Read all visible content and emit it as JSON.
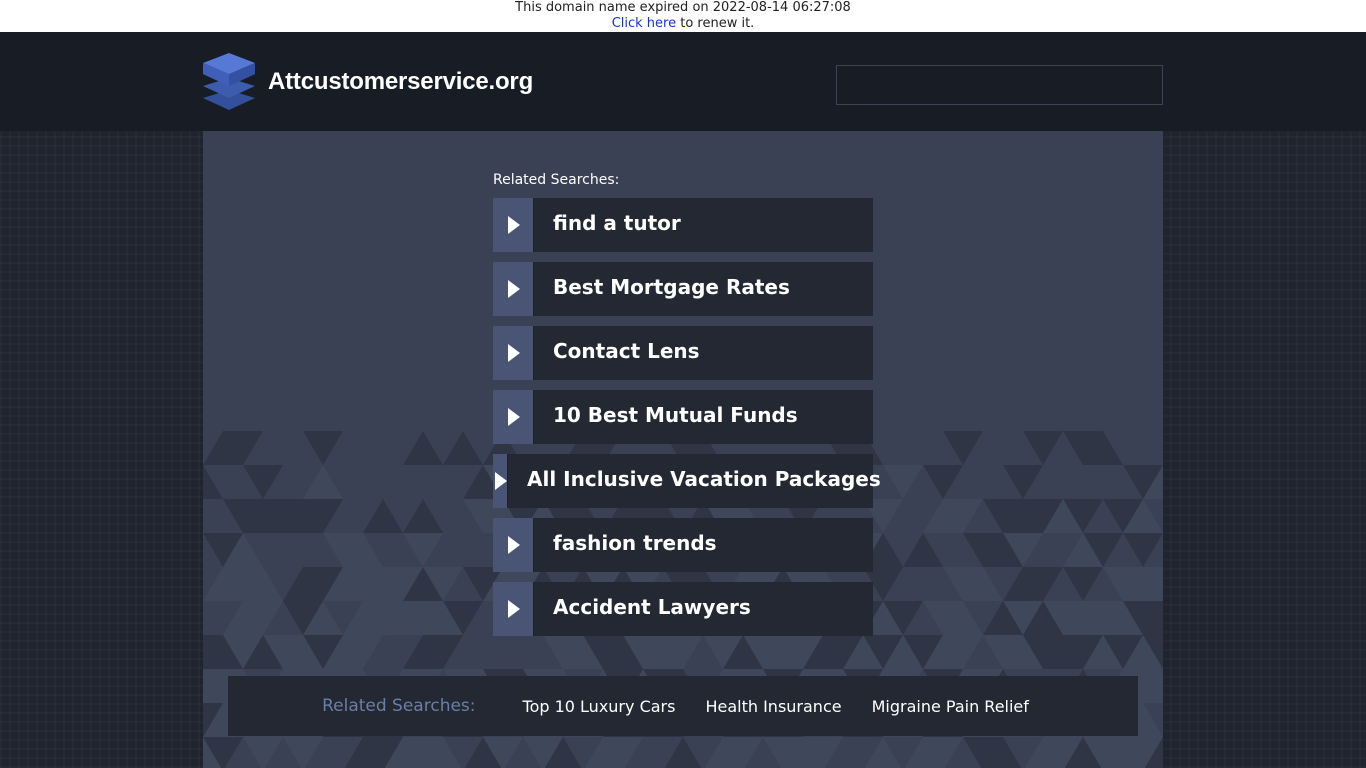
{
  "expiry": {
    "message": "This domain name expired on 2022-08-14 06:27:08",
    "link_text": "Click here",
    "suffix": " to renew it."
  },
  "header": {
    "site_name": "Attcustomerservice.org",
    "logo_icon": "stacked-layers-icon",
    "search_placeholder": "",
    "search_value": ""
  },
  "main": {
    "related_title": "Related Searches:",
    "results": [
      {
        "label": "find a tutor"
      },
      {
        "label": "Best Mortgage Rates"
      },
      {
        "label": "Contact Lens"
      },
      {
        "label": "10 Best Mutual Funds"
      },
      {
        "label": "All Inclusive Vacation Packages"
      },
      {
        "label": "fashion trends"
      },
      {
        "label": "Accident Lawyers"
      }
    ],
    "arrow_icon": "play-arrow-icon"
  },
  "bottom": {
    "title": "Related Searches:",
    "links": [
      {
        "label": "Top 10 Luxury Cars"
      },
      {
        "label": "Health Insurance"
      },
      {
        "label": "Migraine Pain Relief"
      }
    ]
  },
  "colors": {
    "header_bg": "#181c25",
    "panel_bg": "#3a4154",
    "item_bg": "#232832",
    "arrow_bg": "#4a5575",
    "bottom_title": "#6a7ea6",
    "link_blue": "#1a33cc"
  }
}
